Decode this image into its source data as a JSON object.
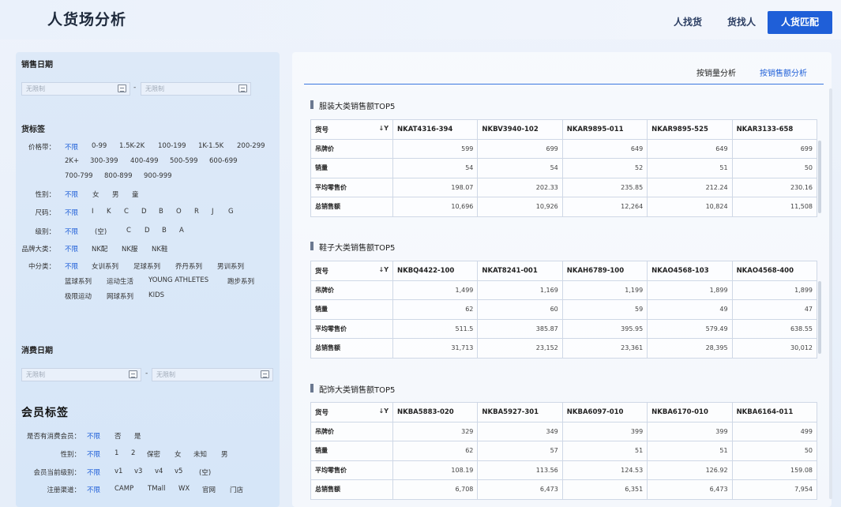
{
  "header": {
    "title": "人货场分析",
    "nav": [
      "人找货",
      "货找人",
      "人货匹配"
    ]
  },
  "filters": {
    "sales_date": {
      "title": "销售日期",
      "start_placeholder": "无限制",
      "end_placeholder": "无限制",
      "separator": "-"
    },
    "goods_tags": {
      "title": "货标签",
      "price_label": "价格带：",
      "price_opts": [
        "不限",
        "0-99",
        "1.5K-2K",
        "100-199",
        "1K-1.5K",
        "200-299",
        "2K+",
        "300-399",
        "400-499",
        "500-599",
        "600-699",
        "700-799",
        "800-899",
        "900-999"
      ],
      "gender_label": "性别：",
      "gender_opts": [
        "不限",
        "女",
        "男",
        "童"
      ],
      "size_label": "尺码：",
      "size_opts": [
        "不限",
        "I",
        "K",
        "C",
        "D",
        "B",
        "O",
        "R",
        "J",
        "G"
      ],
      "level_label": "级别：",
      "level_opts": [
        "不限",
        "(空)",
        "C",
        "D",
        "B",
        "A"
      ],
      "brand_label": "品牌大类：",
      "brand_opts": [
        "不限",
        "NK配",
        "NK服",
        "NK鞋"
      ],
      "mid_label": "中分类：",
      "mid_opts": [
        "不限",
        "女训系列",
        "足球系列",
        "乔丹系列",
        "男训系列",
        "篮球系列",
        "运动生活",
        "YOUNG ATHLETES",
        "跑步系列",
        "极限运动",
        "网球系列",
        "KIDS"
      ]
    },
    "consume_date": {
      "title": "消费日期",
      "start_placeholder": "无限制",
      "end_placeholder": "无限制",
      "separator": "-"
    },
    "member_tags": {
      "title": "会员标签",
      "has_consume_label": "是否有消费会员：",
      "has_consume_opts": [
        "不限",
        "否",
        "是"
      ],
      "gender_label": "性别：",
      "gender_opts": [
        "不限",
        "1",
        "2",
        "保密",
        "女",
        "未知",
        "男"
      ],
      "level_label": "会员当前级别：",
      "level_opts": [
        "不限",
        "v1",
        "v3",
        "v4",
        "v5",
        "(空)"
      ],
      "channel_label": "注册渠道：",
      "channel_opts": [
        "不限",
        "CAMP",
        "TMall",
        "WX",
        "官网",
        "门店"
      ]
    }
  },
  "analysis_tabs": [
    "按销量分析",
    "按销售额分析"
  ],
  "tables": [
    {
      "title": "服装大类销售额TOP5",
      "header_label": "货号",
      "products": [
        "NKAT4316-394",
        "NKBV3940-102",
        "NKAR9895-011",
        "NKAR9895-525",
        "NKAR3133-658"
      ],
      "rows": [
        {
          "label": "吊牌价",
          "values": [
            "599",
            "699",
            "649",
            "649",
            "699"
          ]
        },
        {
          "label": "销量",
          "values": [
            "54",
            "54",
            "52",
            "51",
            "50"
          ]
        },
        {
          "label": "平均零售价",
          "values": [
            "198.07",
            "202.33",
            "235.85",
            "212.24",
            "230.16"
          ]
        },
        {
          "label": "总销售额",
          "values": [
            "10,696",
            "10,926",
            "12,264",
            "10,824",
            "11,508"
          ]
        }
      ]
    },
    {
      "title": "鞋子大类销售额TOP5",
      "header_label": "货号",
      "products": [
        "NKBQ4422-100",
        "NKAT8241-001",
        "NKAH6789-100",
        "NKAO4568-103",
        "NKAO4568-400"
      ],
      "rows": [
        {
          "label": "吊牌价",
          "values": [
            "1,499",
            "1,169",
            "1,199",
            "1,899",
            "1,899"
          ]
        },
        {
          "label": "销量",
          "values": [
            "62",
            "60",
            "59",
            "49",
            "47"
          ]
        },
        {
          "label": "平均零售价",
          "values": [
            "511.5",
            "385.87",
            "395.95",
            "579.49",
            "638.55"
          ]
        },
        {
          "label": "总销售额",
          "values": [
            "31,713",
            "23,152",
            "23,361",
            "28,395",
            "30,012"
          ]
        }
      ]
    },
    {
      "title": "配饰大类销售额TOP5",
      "header_label": "货号",
      "products": [
        "NKBA5883-020",
        "NKBA5927-301",
        "NKBA6097-010",
        "NKBA6170-010",
        "NKBA6164-011"
      ],
      "rows": [
        {
          "label": "吊牌价",
          "values": [
            "329",
            "349",
            "399",
            "399",
            "499"
          ]
        },
        {
          "label": "销量",
          "values": [
            "62",
            "57",
            "51",
            "51",
            "50"
          ]
        },
        {
          "label": "平均零售价",
          "values": [
            "108.19",
            "113.56",
            "124.53",
            "126.92",
            "159.08"
          ]
        },
        {
          "label": "总销售额",
          "values": [
            "6,708",
            "6,473",
            "6,351",
            "6,473",
            "7,954"
          ]
        }
      ]
    }
  ]
}
